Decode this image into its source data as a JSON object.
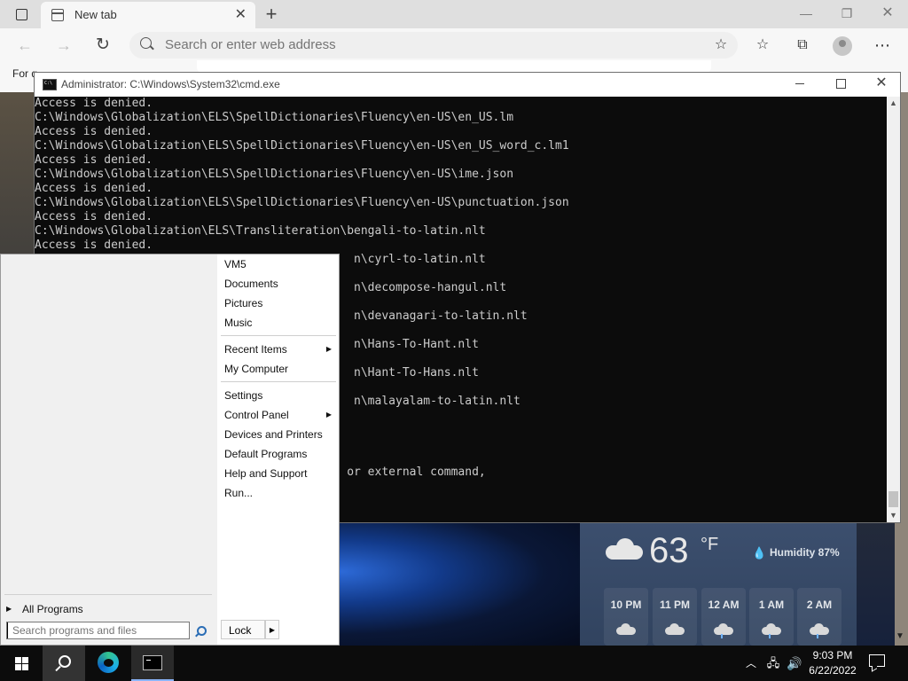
{
  "browser": {
    "tab_title": "New tab",
    "address_placeholder": "Search or enter web address",
    "favbar_text": "For q"
  },
  "cmd": {
    "title": "Administrator: C:\\Windows\\System32\\cmd.exe",
    "lines": [
      "Access is denied.",
      "C:\\Windows\\Globalization\\ELS\\SpellDictionaries\\Fluency\\en-US\\en_US.lm",
      "Access is denied.",
      "C:\\Windows\\Globalization\\ELS\\SpellDictionaries\\Fluency\\en-US\\en_US_word_c.lm1",
      "Access is denied.",
      "C:\\Windows\\Globalization\\ELS\\SpellDictionaries\\Fluency\\en-US\\ime.json",
      "Access is denied.",
      "C:\\Windows\\Globalization\\ELS\\SpellDictionaries\\Fluency\\en-US\\punctuation.json",
      "Access is denied.",
      "C:\\Windows\\Globalization\\ELS\\Transliteration\\bengali-to-latin.nlt",
      "Access is denied.",
      "                                              n\\cyrl-to-latin.nlt",
      "",
      "                                              n\\decompose-hangul.nlt",
      "",
      "                                              n\\devanagari-to-latin.nlt",
      "",
      "                                              n\\Hans-To-Hant.nlt",
      "",
      "                                              n\\Hant-To-Hans.nlt",
      "",
      "                                              n\\malayalam-to-latin.nlt",
      "",
      "",
      "",
      "",
      "                                             or external command,"
    ]
  },
  "start_menu": {
    "right_items": [
      {
        "label": "VM5"
      },
      {
        "label": "Documents"
      },
      {
        "label": "Pictures"
      },
      {
        "label": "Music"
      },
      {
        "label": "Recent Items"
      },
      {
        "label": "My Computer"
      },
      {
        "label": "Settings"
      },
      {
        "label": "Control Panel"
      },
      {
        "label": "Devices and Printers"
      },
      {
        "label": "Default Programs"
      },
      {
        "label": "Help and Support"
      },
      {
        "label": "Run..."
      }
    ],
    "all_programs": "All Programs",
    "search_placeholder": "Search programs and files",
    "lock": "Lock"
  },
  "weather": {
    "temp": "63",
    "unit": "°F",
    "humidity": "Humidity 87%",
    "hours": [
      "10 PM",
      "11 PM",
      "12 AM",
      "1 AM",
      "2 AM"
    ]
  },
  "taskbar": {
    "time": "9:03 PM",
    "date": "6/22/2022"
  }
}
